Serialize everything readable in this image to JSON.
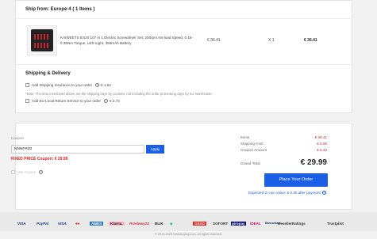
{
  "shipment": {
    "ship_from": "Ship from: Europe-4 ( 1 Items )",
    "product_name": "KAIWEETS ES20 107 in 1 Electric Screwdriver Set, 200rpm No-load Speed, 0.15-0.35Nm Torque, LED Light, 350mAh Battery",
    "price": "€ 36.41",
    "qty": "X 1",
    "subtotal": "€ 36.41"
  },
  "shipping_delivery": {
    "title": "Shipping & Delivery",
    "insurance_label": "Add Shipping Insurance to your order",
    "insurance_price": "€ 1.62",
    "note": "*Note: The time mentioned above are the shipping days by couriers, not including the order processing days by our warehouse.",
    "return_label": "Add EU Local Return Service to your order",
    "return_price": "€ 2.72"
  },
  "coupon": {
    "label": "Coupon",
    "code": "NNNFR20",
    "apply_label": "Apply",
    "fixed_price": "FIXED PRICE Coupon: € 29.99",
    "faded_label": "Use G coins"
  },
  "summary": {
    "items_label": "Items",
    "items_value": "€ 36.41",
    "shipping_label": "Shipping Cost",
    "shipping_value": "€ 0.00",
    "coupon_label": "Coupon Amount",
    "coupon_value": "- € 6.42",
    "grand_label": "Grand Total",
    "grand_value": "€ 29.99",
    "place_order": "Place Your Order",
    "g_coin_text": "Expected G coin value: € 0.30 after payment"
  },
  "payments": [
    "VISA",
    "PayPal",
    "VISA",
    "●●",
    "AMEX",
    "Klarna.",
    "Przelewy24",
    "BLIK",
    "◆",
    "OXXO",
    "SOFORT",
    "giropay",
    "iDEAL",
    "Bancontact",
    "ResellerRatings",
    "Trustpilot"
  ],
  "footer": {
    "copyright": "© 2013-2023 Geekbuying.com. All rights reserved."
  },
  "colors": {
    "accent": "#1a5fe6",
    "danger": "#e02020"
  }
}
